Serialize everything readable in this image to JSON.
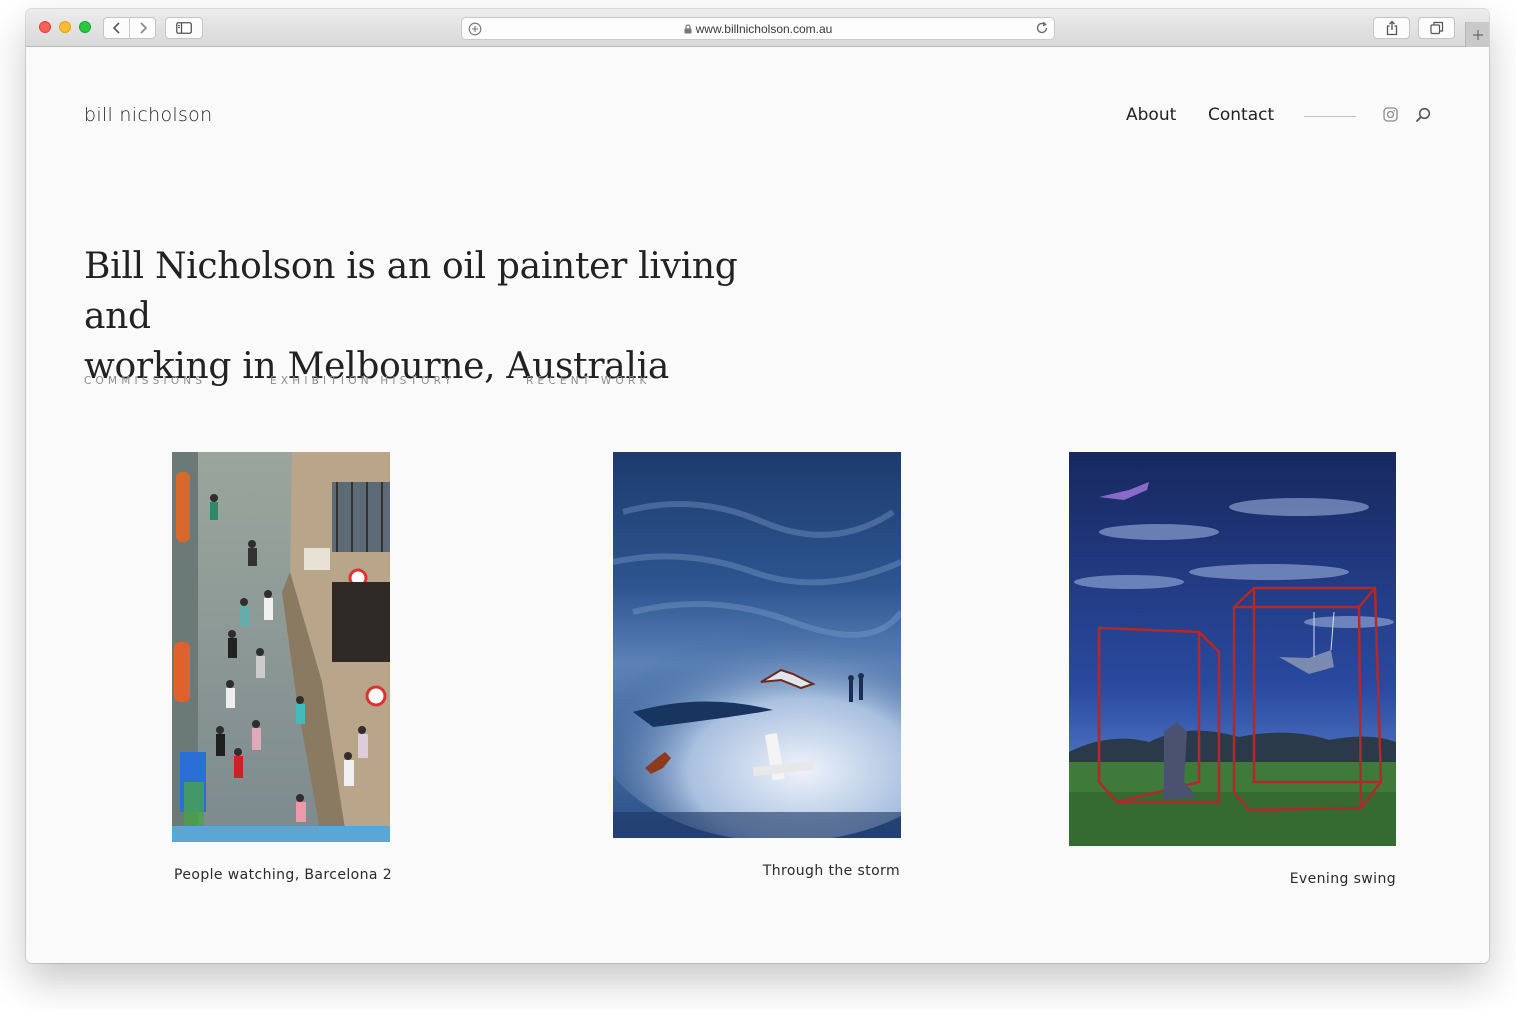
{
  "browser": {
    "url": "www.billnicholson.com.au"
  },
  "site": {
    "logo": "bill nicholson",
    "nav": {
      "about": "About",
      "contact": "Contact"
    },
    "hero_line_1": "Bill Nicholson is an oil painter living and",
    "hero_line_2": "working in Melbourne, Australia",
    "categories": [
      "COMMISSIONS",
      "EXHIBITION HISTORY",
      "RECENT WORK"
    ]
  },
  "artworks": [
    {
      "title": "People watching, Barcelona 2"
    },
    {
      "title": "Through the storm"
    },
    {
      "title": "Evening swing"
    }
  ],
  "colors": {
    "page_bg": "#fafafa",
    "text": "#222222",
    "muted_text": "#8c8c8c"
  }
}
